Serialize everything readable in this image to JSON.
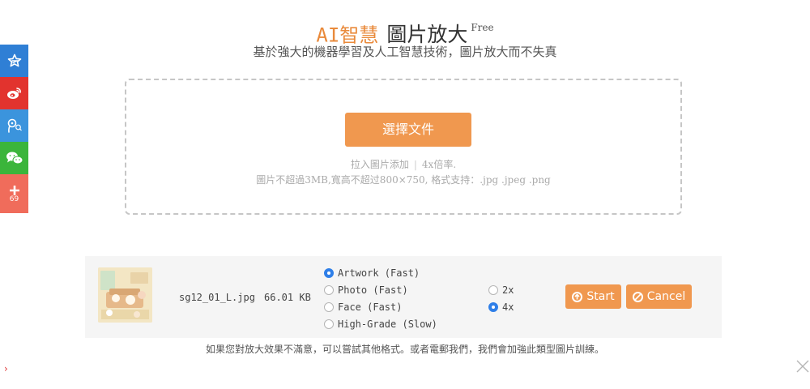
{
  "header": {
    "title_accent": "AI智慧",
    "title_main": "圖片放大",
    "title_badge": "Free",
    "subtitle": "基於強大的機器學習及人工智慧技術，圖片放大而不失真"
  },
  "upload": {
    "select_button_label": "選擇文件",
    "hint_drag": "拉入圖片添加",
    "hint_scale": "4x倍率.",
    "limits": "圖片不超過3MB,寬高不超过800×750, 格式支持：.jpg .jpeg .png"
  },
  "file": {
    "name": "sg12_01_L.jpg",
    "size": "66.01 KB",
    "thumbnail_icon": "image-thumbnail",
    "mode_options": [
      {
        "label": "Artwork (Fast)",
        "checked": true
      },
      {
        "label": "Photo (Fast)",
        "checked": false
      },
      {
        "label": "Face (Fast)",
        "checked": false
      },
      {
        "label": "High-Grade (Slow)",
        "checked": false
      }
    ],
    "scale_options": [
      {
        "label": "2x",
        "checked": false
      },
      {
        "label": "4x",
        "checked": true
      }
    ],
    "start_label": "Start",
    "cancel_label": "Cancel"
  },
  "footer": {
    "note": "如果您對放大效果不滿意，可以嘗試其他格式。或者電郵我們，我們會加強此類型圖片訓練。"
  },
  "share": {
    "items": [
      {
        "name": "qzone-star-icon",
        "color": "#2f7fd5"
      },
      {
        "name": "weibo-icon",
        "color": "#e2332e"
      },
      {
        "name": "tencent-weibo-icon",
        "color": "#3b94dd"
      },
      {
        "name": "wechat-icon",
        "color": "#3bb53b"
      },
      {
        "name": "plus-icon",
        "color": "#f06c5b"
      }
    ],
    "count": "69"
  },
  "colors": {
    "accent": "#f0984f",
    "title_accent": "#e98a3b",
    "radio_checked": "#2f7fe8"
  },
  "controls": {
    "collapse_arrow": "›"
  }
}
